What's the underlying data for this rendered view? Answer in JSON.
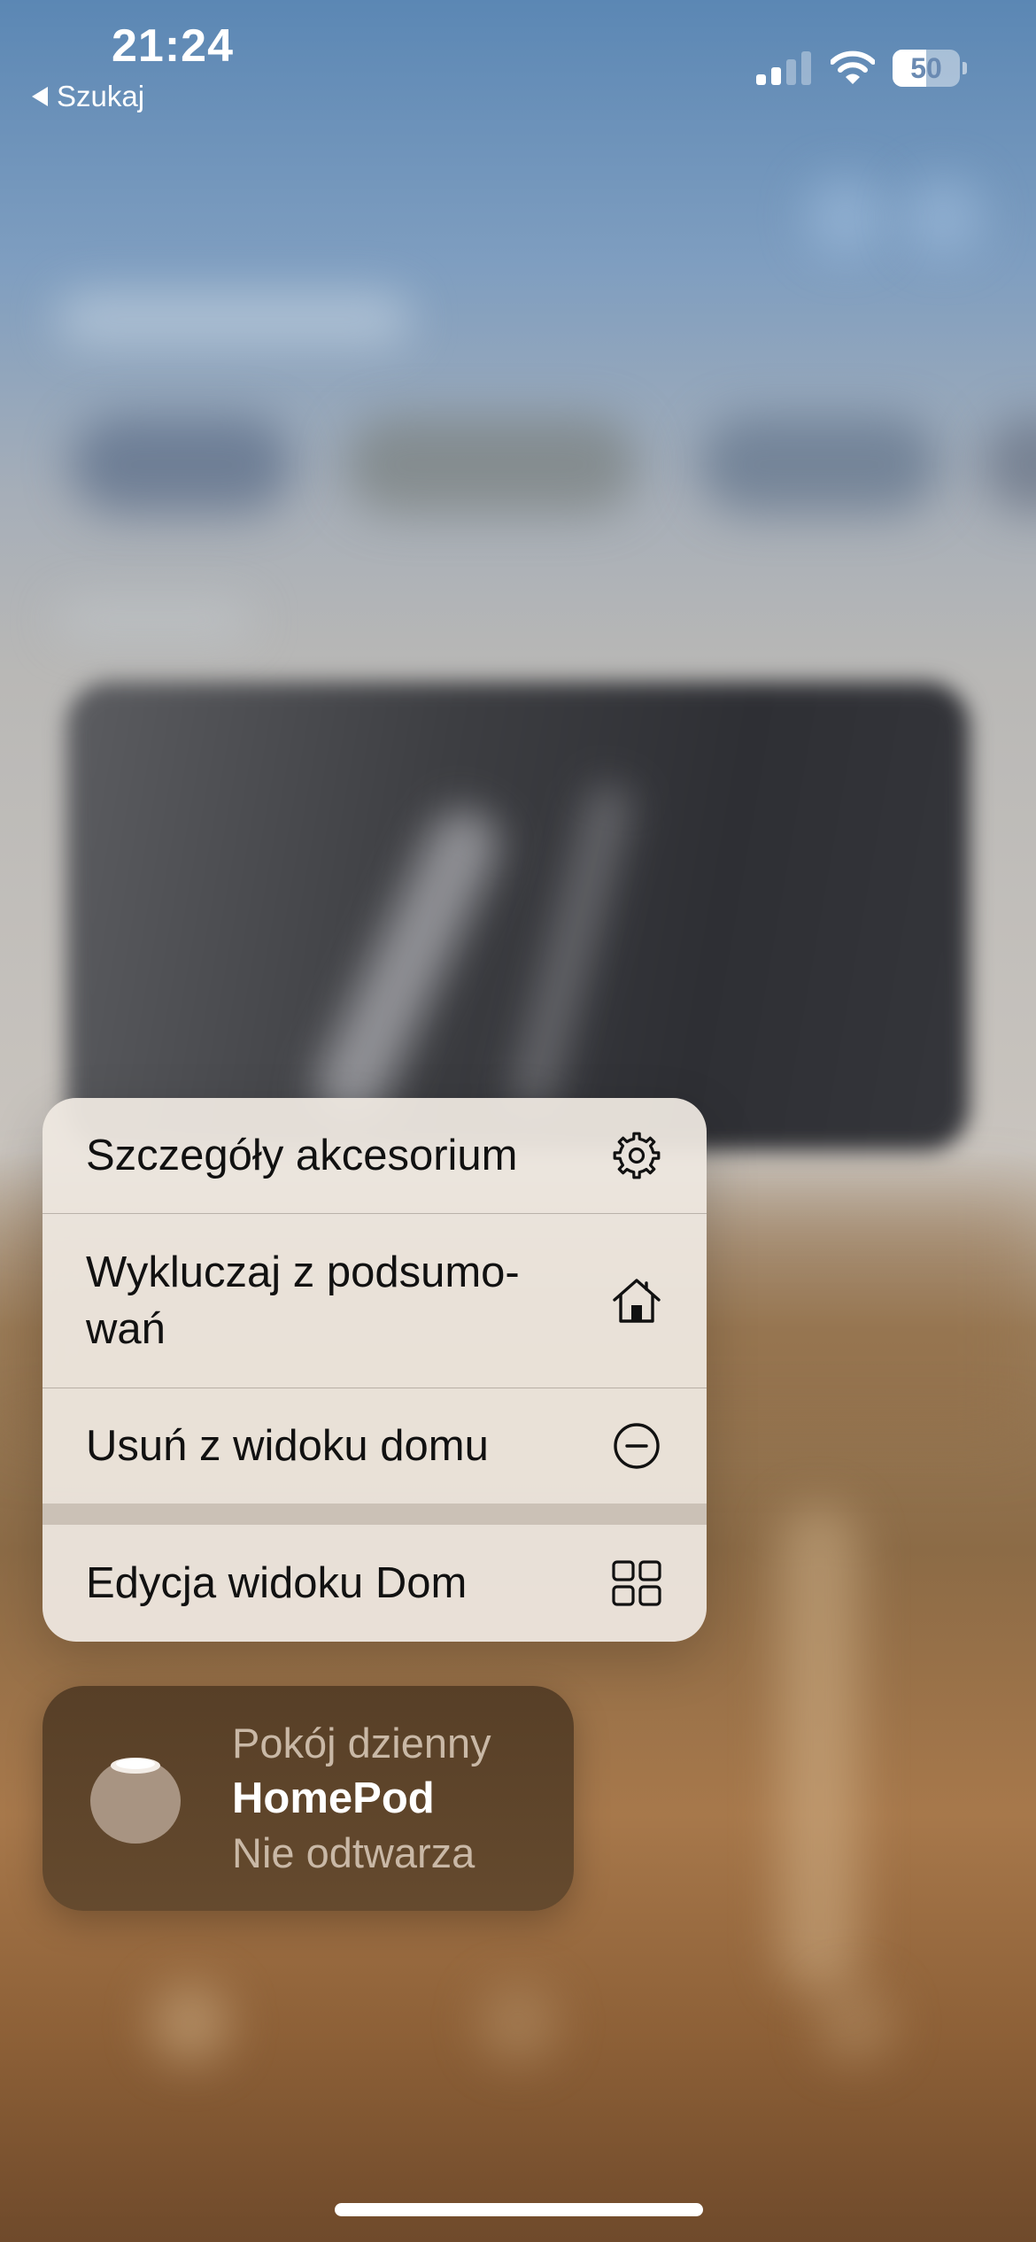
{
  "status_bar": {
    "time": "21:24",
    "back_label": "Szukaj",
    "battery_level": "50",
    "battery_fraction": 0.5,
    "signal_bars_active": 2,
    "signal_bars_total": 4
  },
  "context_menu": {
    "items": [
      {
        "label": "Szczegóły akcesorium",
        "icon": "gear-icon"
      },
      {
        "label": "Wykluczaj z podsumo-\nwań",
        "icon": "house-icon"
      },
      {
        "label": "Usuń z widoku domu",
        "icon": "minus-circle-icon"
      },
      {
        "label": "Edycja widoku Dom",
        "icon": "grid-icon"
      }
    ]
  },
  "accessory_tile": {
    "room": "Pokój dzienny",
    "name": "HomePod",
    "status": "Nie odtwarza",
    "icon": "homepod-mini-icon"
  },
  "colors": {
    "menu_background": "#eee8e0",
    "tile_background": "#5c4329",
    "text_primary": "#111111",
    "tile_secondary_text": "#c9b8a6"
  }
}
